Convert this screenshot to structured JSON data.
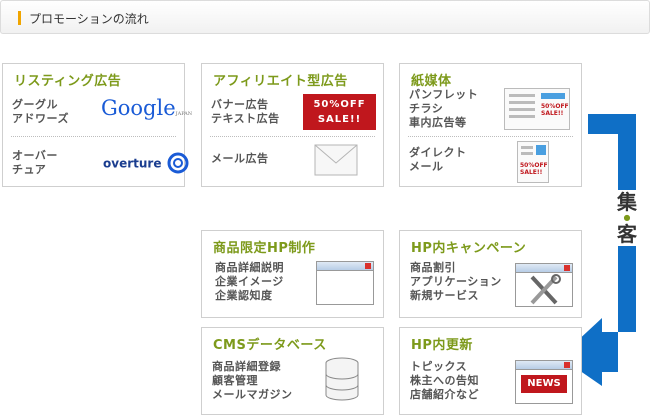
{
  "header": {
    "title": "プロモーションの流れ"
  },
  "boxes": {
    "listing": {
      "title": "リスティング広告",
      "row1": {
        "line1": "グーグル",
        "line2": "アドワーズ",
        "logo": "Google",
        "logo_suffix": "JAPAN"
      },
      "row2": {
        "line1": "オーバー",
        "line2": "チュア",
        "logo": "overture"
      }
    },
    "affiliate": {
      "title": "アフィリエイト型広告",
      "row1": {
        "line1": "バナー広告",
        "line2": "テキスト広告",
        "banner_line1": "50%OFF",
        "banner_line2": "SALE!!"
      },
      "row2": {
        "line1": "メール広告"
      }
    },
    "paper": {
      "title": "紙媒体",
      "row1": {
        "line1": "パンフレット",
        "line2": "チラシ",
        "line3": "車内広告等",
        "flyer_line1": "50%OFF",
        "flyer_line2": "SALE!!"
      },
      "row2": {
        "line1": "ダイレクト",
        "line2": "メール",
        "flyer_line1": "50%OFF",
        "flyer_line2": "SALE!!"
      }
    },
    "limited": {
      "title": "商品限定HP制作",
      "line1": "商品詳細説明",
      "line2": "企業イメージ",
      "line3": "企業認知度"
    },
    "campaign": {
      "title": "HP内キャンペーン",
      "line1": "商品割引",
      "line2": "アプリケーション",
      "line3": "新規サービス"
    },
    "cms": {
      "title": "CMSデータベース",
      "line1": "商品詳細登録",
      "line2": "顧客管理",
      "line3": "メールマガジン"
    },
    "update": {
      "title": "HP内更新",
      "line1": "トピックス",
      "line2": "株主への告知",
      "line3": "店舗紹介など",
      "news_label": "NEWS"
    }
  },
  "collect": {
    "char1": "集",
    "char2": "客"
  },
  "colors": {
    "accent": "#7d9a1b",
    "arrow": "#0f6fc6",
    "header_bar": "#f0a500",
    "banner": "#c0171d"
  }
}
